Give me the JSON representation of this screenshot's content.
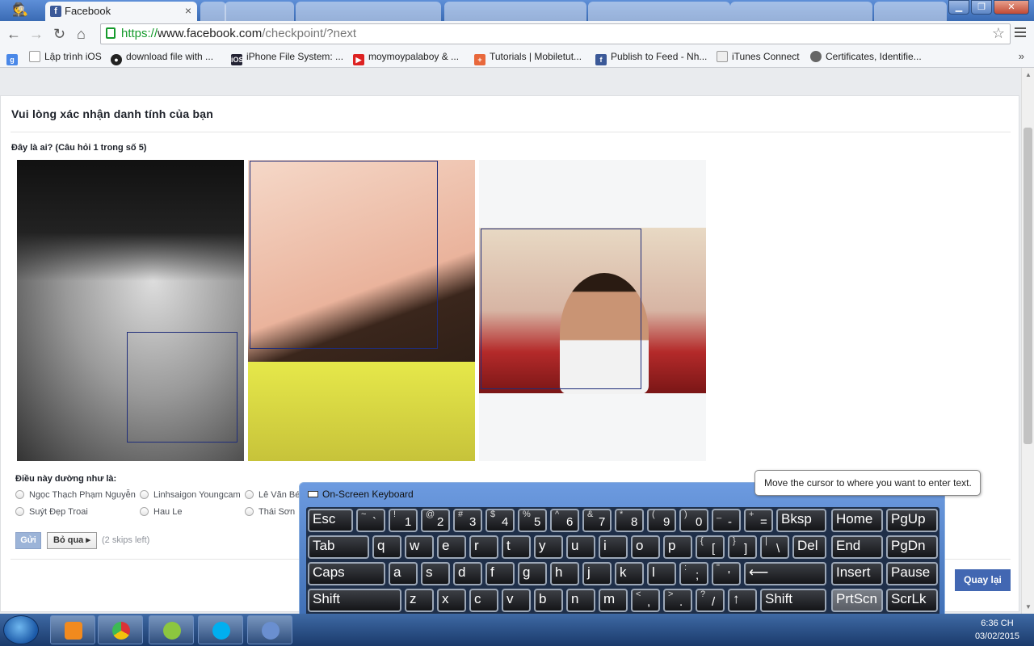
{
  "browser": {
    "tabs": [
      {
        "label": "Facebook",
        "active": true
      },
      {
        "label": "",
        "active": false
      },
      {
        "label": "",
        "active": false
      },
      {
        "label": "",
        "active": false
      },
      {
        "label": "",
        "active": false
      },
      {
        "label": "",
        "active": false
      },
      {
        "label": "",
        "active": false
      },
      {
        "label": "",
        "active": false
      }
    ],
    "url_scheme": "https://",
    "url_host": "www.facebook.com",
    "url_path": "/checkpoint/?next",
    "bookmarks": [
      {
        "label": "Lập trình iOS",
        "icon": "document-icon"
      },
      {
        "label": "download file with ...",
        "icon": "github-icon"
      },
      {
        "label": "iPhone File System: ...",
        "icon": "ios-icon"
      },
      {
        "label": "moymoypalaboy & ...",
        "icon": "youtube-icon"
      },
      {
        "label": "Tutorials | Mobiletut...",
        "icon": "plus-icon"
      },
      {
        "label": "Publish to Feed - Nh...",
        "icon": "facebook-icon"
      },
      {
        "label": "iTunes Connect",
        "icon": "page-icon"
      },
      {
        "label": "Certificates, Identifie...",
        "icon": "apple-icon"
      }
    ],
    "bookmarks_more": "»"
  },
  "checkpoint": {
    "title": "Vui lòng xác nhận danh tính của bạn",
    "question": "Đây là ai? (Câu hỏi 1 trong số 5)",
    "answers_label": "Điều này dường như là:",
    "options": [
      "Ngọc Thạch Phạm Nguyễn",
      "Linhsaigon Youngcam",
      "Lê Văn Bé",
      "Suýt Đẹp Troai",
      "Hau Le",
      "Thái Sơn"
    ],
    "send_label": "Gửi",
    "skip_label": "Bỏ qua ▸",
    "skips_left": "(2 skips left)",
    "back_label": "Quay lại"
  },
  "osk": {
    "title": "On-Screen Keyboard",
    "tooltip": "Move the cursor to where you want to enter text."
  },
  "taskbar": {
    "time": "6:36 CH",
    "date": "03/02/2015"
  }
}
